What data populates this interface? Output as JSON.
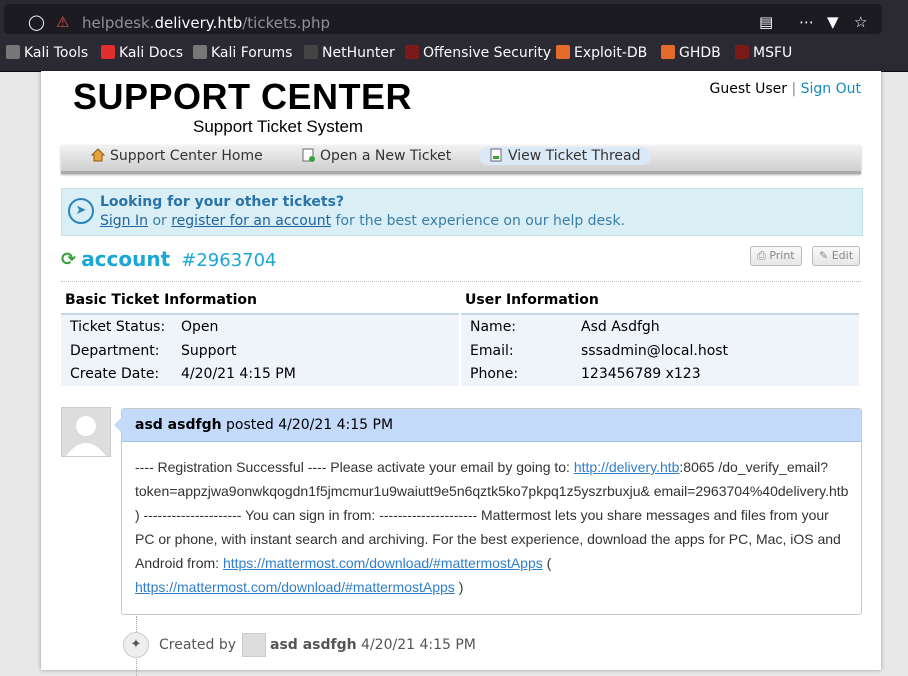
{
  "browser": {
    "url_host": "helpdesk.",
    "url_domain": "delivery.htb",
    "url_path": "/tickets.php",
    "bookmarks": [
      {
        "label": "Kali Tools",
        "color": "#aaaaaa"
      },
      {
        "label": "Kali Docs",
        "color": "#e22d2d"
      },
      {
        "label": "Kali Forums",
        "color": "#aaaaaa"
      },
      {
        "label": "NetHunter",
        "color": "#444444"
      },
      {
        "label": "Offensive Security",
        "color": "#7a1b1b"
      },
      {
        "label": "Exploit-DB",
        "color": "#e46b2b"
      },
      {
        "label": "GHDB",
        "color": "#e46b2b"
      },
      {
        "label": "MSFU",
        "color": "#7a1b1b"
      }
    ]
  },
  "header": {
    "logo_big": "SUPPORT CENTER",
    "logo_small": "Support Ticket System",
    "guest": "Guest User",
    "separator": "|",
    "sign_out": "Sign Out"
  },
  "nav": {
    "home": "Support Center Home",
    "new_ticket": "Open a New Ticket",
    "view_thread": "View Ticket Thread"
  },
  "notice": {
    "title": "Looking for your other tickets?",
    "sign_in": "Sign In",
    "or": "or",
    "register": "register for an account",
    "rest": "for the best experience on our help desk."
  },
  "ticket": {
    "subject": "account",
    "number": "#2963704",
    "print": "Print",
    "edit": "Edit"
  },
  "basic_info": {
    "heading": "Basic Ticket Information",
    "rows": [
      {
        "label": "Ticket Status:",
        "value": "Open"
      },
      {
        "label": "Department:",
        "value": "Support"
      },
      {
        "label": "Create Date:",
        "value": "4/20/21 4:15 PM"
      }
    ]
  },
  "user_info": {
    "heading": "User Information",
    "rows": [
      {
        "label": "Name:",
        "value": "Asd Asdfgh"
      },
      {
        "label": "Email:",
        "value": "sssadmin@local.host"
      },
      {
        "label": "Phone:",
        "value": "123456789 x123"
      }
    ]
  },
  "thread": {
    "author": "asd asdfgh",
    "posted": "posted",
    "date": "4/20/21 4:15 PM",
    "msg_part1": "---- Registration Successful ---- Please activate your email by going to: ",
    "link1": "http://delivery.htb",
    "msg_part2": ":8065 /do_verify_email?token=appzjwa9onwkqogdn1f5jmcmur1u9waiutt9e5n6qztk5ko7pkpq1z5yszrbuxju& email=2963704%40delivery.htb ) --------------------- You can sign in from: --------------------- Mattermost lets you share messages and files from your PC or phone, with instant search and archiving. For the best experience, download the apps for PC, Mac, iOS and Android from: ",
    "link2": "https://mattermost.com/download/#mattermostApps",
    "msg_part3": " ( ",
    "link3": "https://mattermost.com/download/#mattermostApps",
    "msg_part4": " )"
  },
  "created": {
    "label": "Created by",
    "author": "asd asdfgh",
    "date": "4/20/21 4:15 PM"
  }
}
